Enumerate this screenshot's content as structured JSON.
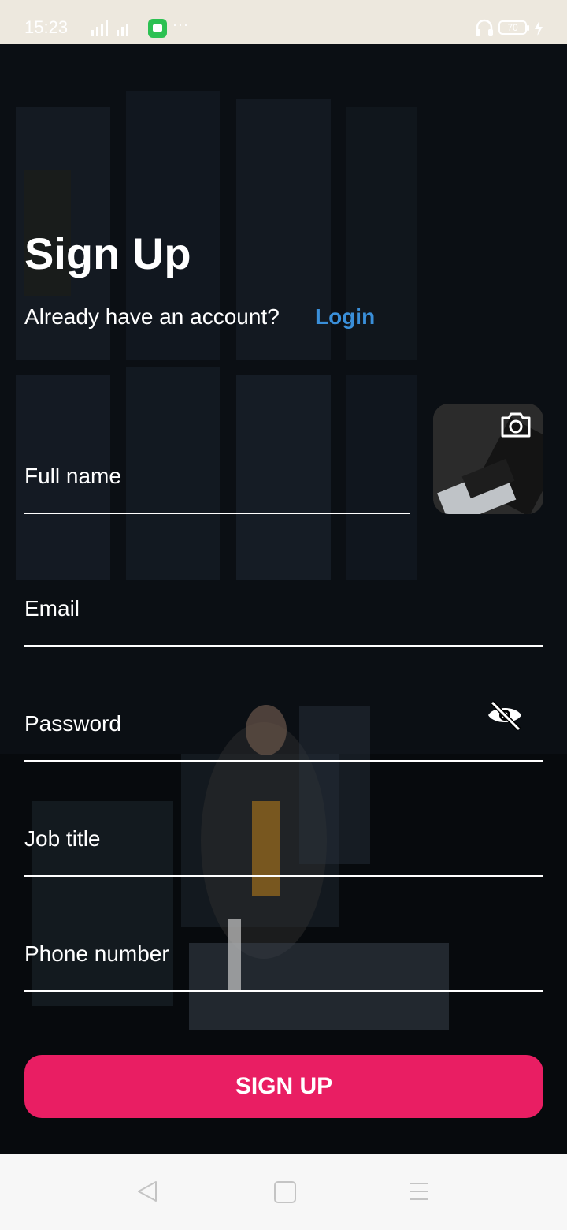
{
  "status_bar": {
    "time": "15:23",
    "battery": "70"
  },
  "form": {
    "title": "Sign Up",
    "prompt": "Already have an account?",
    "login_link": "Login",
    "fields": {
      "full_name": {
        "placeholder": "Full name",
        "value": ""
      },
      "email": {
        "placeholder": "Email",
        "value": ""
      },
      "password": {
        "placeholder": "Password",
        "value": ""
      },
      "job_title": {
        "placeholder": "Job title",
        "value": ""
      },
      "phone_number": {
        "placeholder": "Phone number",
        "value": ""
      }
    },
    "submit_label": "SIGN UP"
  },
  "icons": {
    "camera": "camera-icon",
    "password_visibility": "eye-off-icon",
    "nav_back": "triangle-back-icon",
    "nav_home": "square-home-icon",
    "nav_menu": "hamburger-menu-icon"
  },
  "colors": {
    "accent": "#e91e63",
    "link": "#3a8fd9",
    "status_bar_bg": "#ede8de",
    "nav_bar_bg": "#f7f7f7"
  }
}
